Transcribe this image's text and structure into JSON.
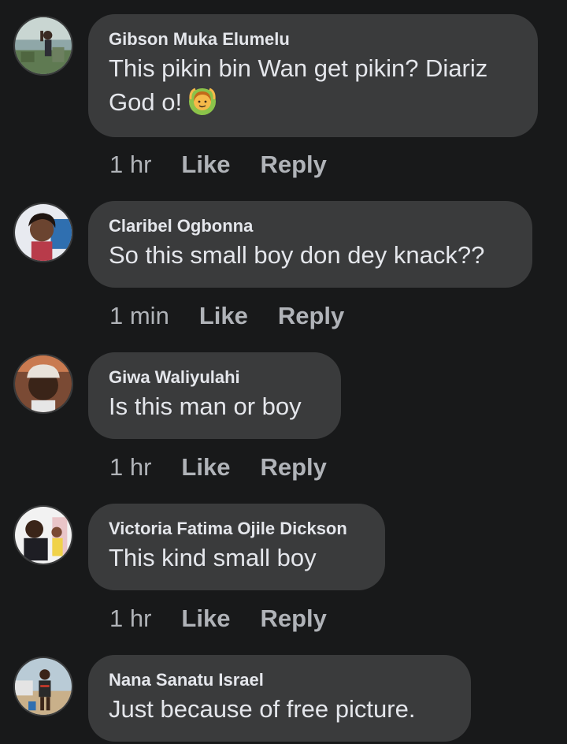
{
  "colors": {
    "background": "#18191a",
    "bubble": "#3a3b3c",
    "primary_text": "#e4e6eb",
    "secondary_text": "#b0b3b8"
  },
  "comments": [
    {
      "author": "Gibson Muka Elumelu",
      "text_line1": "This pikin bin Wan get pikin? Diariz",
      "text_line2": "God o!",
      "emoji": "person-gesturing-ok-emoji",
      "time": "1 hr",
      "like": "Like",
      "reply": "Reply"
    },
    {
      "author": "Claribel Ogbonna",
      "text": "So this small boy don dey knack??",
      "time": "1 min",
      "like": "Like",
      "reply": "Reply"
    },
    {
      "author": "Giwa Waliyulahi",
      "text": "Is this man or boy",
      "time": "1 hr",
      "like": "Like",
      "reply": "Reply"
    },
    {
      "author": "Victoria Fatima Ojile Dickson",
      "text": "This kind small boy",
      "time": "1 hr",
      "like": "Like",
      "reply": "Reply"
    },
    {
      "author": "Nana Sanatu Israel",
      "text": "Just because of free picture."
    }
  ]
}
